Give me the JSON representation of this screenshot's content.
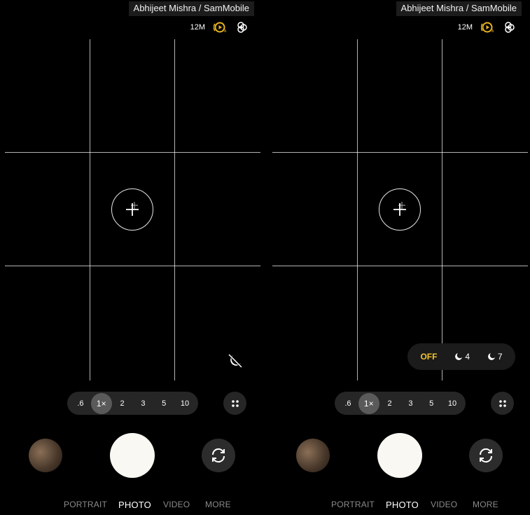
{
  "watermark": "Abhijeet Mishra / SamMobile",
  "status": {
    "resolution": "12M",
    "motion_icon": "motion-photo-icon",
    "filter_icon": "filter-icon"
  },
  "zoom": {
    "levels": [
      ".6",
      "1×",
      "2",
      "3",
      "5",
      "10"
    ],
    "selected": "1×"
  },
  "night_mode": {
    "options": [
      {
        "label": "OFF"
      },
      {
        "label": "4"
      },
      {
        "label": "7"
      }
    ],
    "selected": "OFF"
  },
  "modes": {
    "portrait": "PORTRAIT",
    "photo": "PHOTO",
    "video": "VIDEO",
    "more": "MORE",
    "selected": "PHOTO"
  },
  "colors": {
    "accent_yellow": "#f2c230",
    "motion_icon_yellow": "#e8b320",
    "background": "#000000",
    "shutter": "#faf8f3"
  }
}
